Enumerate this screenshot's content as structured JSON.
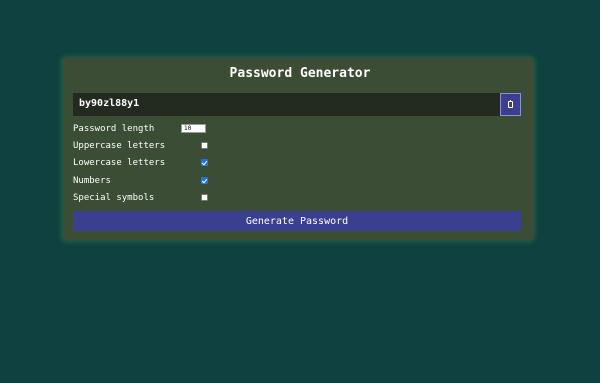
{
  "app": {
    "title": "Password Generator"
  },
  "result": {
    "password": "by90zl88y1",
    "copy_icon": "clipboard-icon"
  },
  "options": {
    "length_label": "Password length",
    "length_value": "10",
    "uppercase_label": "Uppercase letters",
    "uppercase_checked": false,
    "lowercase_label": "Lowercase letters",
    "lowercase_checked": true,
    "numbers_label": "Numbers",
    "numbers_checked": true,
    "symbols_label": "Special symbols",
    "symbols_checked": false
  },
  "actions": {
    "generate_label": "Generate Password"
  },
  "colors": {
    "background": "#0e413f",
    "card": "#3b4d35",
    "accent": "#3a3f8f",
    "result_bg": "#232b20"
  }
}
